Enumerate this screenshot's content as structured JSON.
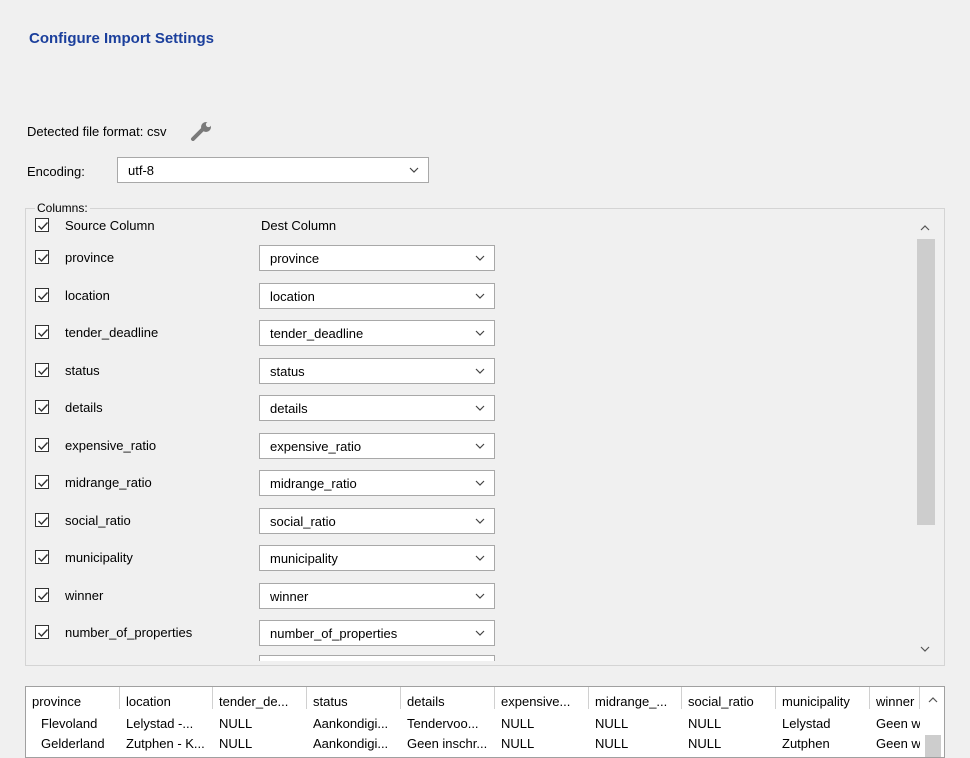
{
  "header": {
    "title": "Configure Import Settings"
  },
  "detected": {
    "label": "Detected file format: csv",
    "icon": "wrench-icon"
  },
  "encoding": {
    "label": "Encoding:",
    "value": "utf-8"
  },
  "columns": {
    "legend": "Columns:",
    "source_header": "Source Column",
    "dest_header": "Dest Column",
    "header_checked": true,
    "rows": [
      {
        "source": "province",
        "dest": "province",
        "checked": true
      },
      {
        "source": "location",
        "dest": "location",
        "checked": true
      },
      {
        "source": "tender_deadline",
        "dest": "tender_deadline",
        "checked": true
      },
      {
        "source": "status",
        "dest": "status",
        "checked": true
      },
      {
        "source": "details",
        "dest": "details",
        "checked": true
      },
      {
        "source": "expensive_ratio",
        "dest": "expensive_ratio",
        "checked": true
      },
      {
        "source": "midrange_ratio",
        "dest": "midrange_ratio",
        "checked": true
      },
      {
        "source": "social_ratio",
        "dest": "social_ratio",
        "checked": true
      },
      {
        "source": "municipality",
        "dest": "municipality",
        "checked": true
      },
      {
        "source": "winner",
        "dest": "winner",
        "checked": true
      },
      {
        "source": "number_of_properties",
        "dest": "number_of_properties",
        "checked": true
      }
    ]
  },
  "preview": {
    "headers": [
      "province",
      "location",
      "tender_de...",
      "status",
      "details",
      "expensive...",
      "midrange_...",
      "social_ratio",
      "municipality",
      "winner"
    ],
    "rows": [
      [
        "Flevoland",
        "Lelystad -...",
        "NULL",
        "Aankondigi...",
        "Tendervoo...",
        "NULL",
        "NULL",
        "NULL",
        "Lelystad",
        "Geen w"
      ],
      [
        "Gelderland",
        "Zutphen - K...",
        "NULL",
        "Aankondigi...",
        "Geen inschr...",
        "NULL",
        "NULL",
        "NULL",
        "Zutphen",
        "Geen w"
      ]
    ]
  },
  "colors": {
    "title": "#1b3f9c",
    "background": "#f0f0f0",
    "scroll_thumb": "#cdcdcd"
  }
}
